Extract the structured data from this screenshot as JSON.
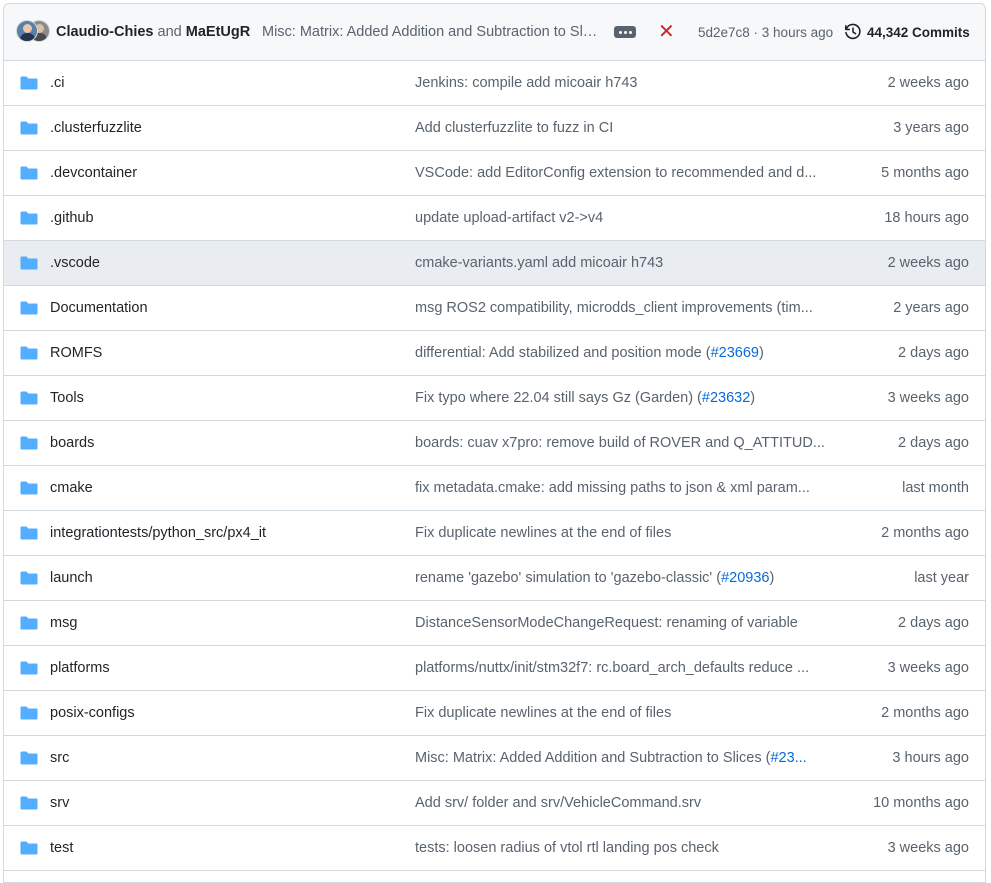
{
  "commit_header": {
    "author_1": "Claudio-Chies",
    "and_text": "and",
    "author_2": "MaEtUgR",
    "message": "Misc: Matrix: Added Addition and Subtraction to Slices",
    "sha_time": "5d2e7c8 · 3 hours ago",
    "commits_label": "44,342 Commits",
    "status": "failure",
    "status_color": "#d1242f"
  },
  "colors": {
    "folder": "#54aeff",
    "link": "#0969da",
    "muted": "#59636e",
    "highlight_row": "#e9ecf0"
  },
  "rows": [
    {
      "name": ".ci",
      "message": "Jenkins: compile add micoair h743",
      "ref": "",
      "suffix": "",
      "age": "2 weeks ago"
    },
    {
      "name": ".clusterfuzzlite",
      "message": "Add clusterfuzzlite to fuzz in CI",
      "ref": "",
      "suffix": "",
      "age": "3 years ago"
    },
    {
      "name": ".devcontainer",
      "message": "VSCode: add EditorConfig extension to recommended and d...",
      "ref": "",
      "suffix": "",
      "age": "5 months ago"
    },
    {
      "name": ".github",
      "message": "update upload-artifact v2->v4",
      "ref": "",
      "suffix": "",
      "age": "18 hours ago"
    },
    {
      "name": ".vscode",
      "message": "cmake-variants.yaml add micoair h743",
      "ref": "",
      "suffix": "",
      "age": "2 weeks ago",
      "highlighted": true
    },
    {
      "name": "Documentation",
      "message": "msg ROS2 compatibility, microdds_client improvements (tim...",
      "ref": "",
      "suffix": "",
      "age": "2 years ago"
    },
    {
      "name": "ROMFS",
      "message": "differential: Add stabilized and position mode (",
      "ref": "#23669",
      "suffix": ")",
      "age": "2 days ago"
    },
    {
      "name": "Tools",
      "message": "Fix typo where 22.04 still says Gz (Garden) (",
      "ref": "#23632",
      "suffix": ")",
      "age": "3 weeks ago"
    },
    {
      "name": "boards",
      "message": "boards: cuav x7pro: remove build of ROVER and Q_ATTITUD...",
      "ref": "",
      "suffix": "",
      "age": "2 days ago"
    },
    {
      "name": "cmake",
      "message": "fix metadata.cmake: add missing paths to json & xml param...",
      "ref": "",
      "suffix": "",
      "age": "last month"
    },
    {
      "name": "integrationtests/python_src/px4_it",
      "message": "Fix duplicate newlines at the end of files",
      "ref": "",
      "suffix": "",
      "age": "2 months ago"
    },
    {
      "name": "launch",
      "message": "rename 'gazebo' simulation to 'gazebo-classic' (",
      "ref": "#20936",
      "suffix": ")",
      "age": "last year"
    },
    {
      "name": "msg",
      "message": "DistanceSensorModeChangeRequest: renaming of variable",
      "ref": "",
      "suffix": "",
      "age": "2 days ago"
    },
    {
      "name": "platforms",
      "message": "platforms/nuttx/init/stm32f7: rc.board_arch_defaults reduce ...",
      "ref": "",
      "suffix": "",
      "age": "3 weeks ago"
    },
    {
      "name": "posix-configs",
      "message": "Fix duplicate newlines at the end of files",
      "ref": "",
      "suffix": "",
      "age": "2 months ago"
    },
    {
      "name": "src",
      "message": "Misc: Matrix: Added Addition and Subtraction to Slices (",
      "ref": "#23...",
      "suffix": "",
      "age": "3 hours ago"
    },
    {
      "name": "srv",
      "message": "Add srv/ folder and srv/VehicleCommand.srv",
      "ref": "",
      "suffix": "",
      "age": "10 months ago"
    },
    {
      "name": "test",
      "message": "tests: loosen radius of vtol rtl landing pos check",
      "ref": "",
      "suffix": "",
      "age": "3 weeks ago"
    }
  ]
}
